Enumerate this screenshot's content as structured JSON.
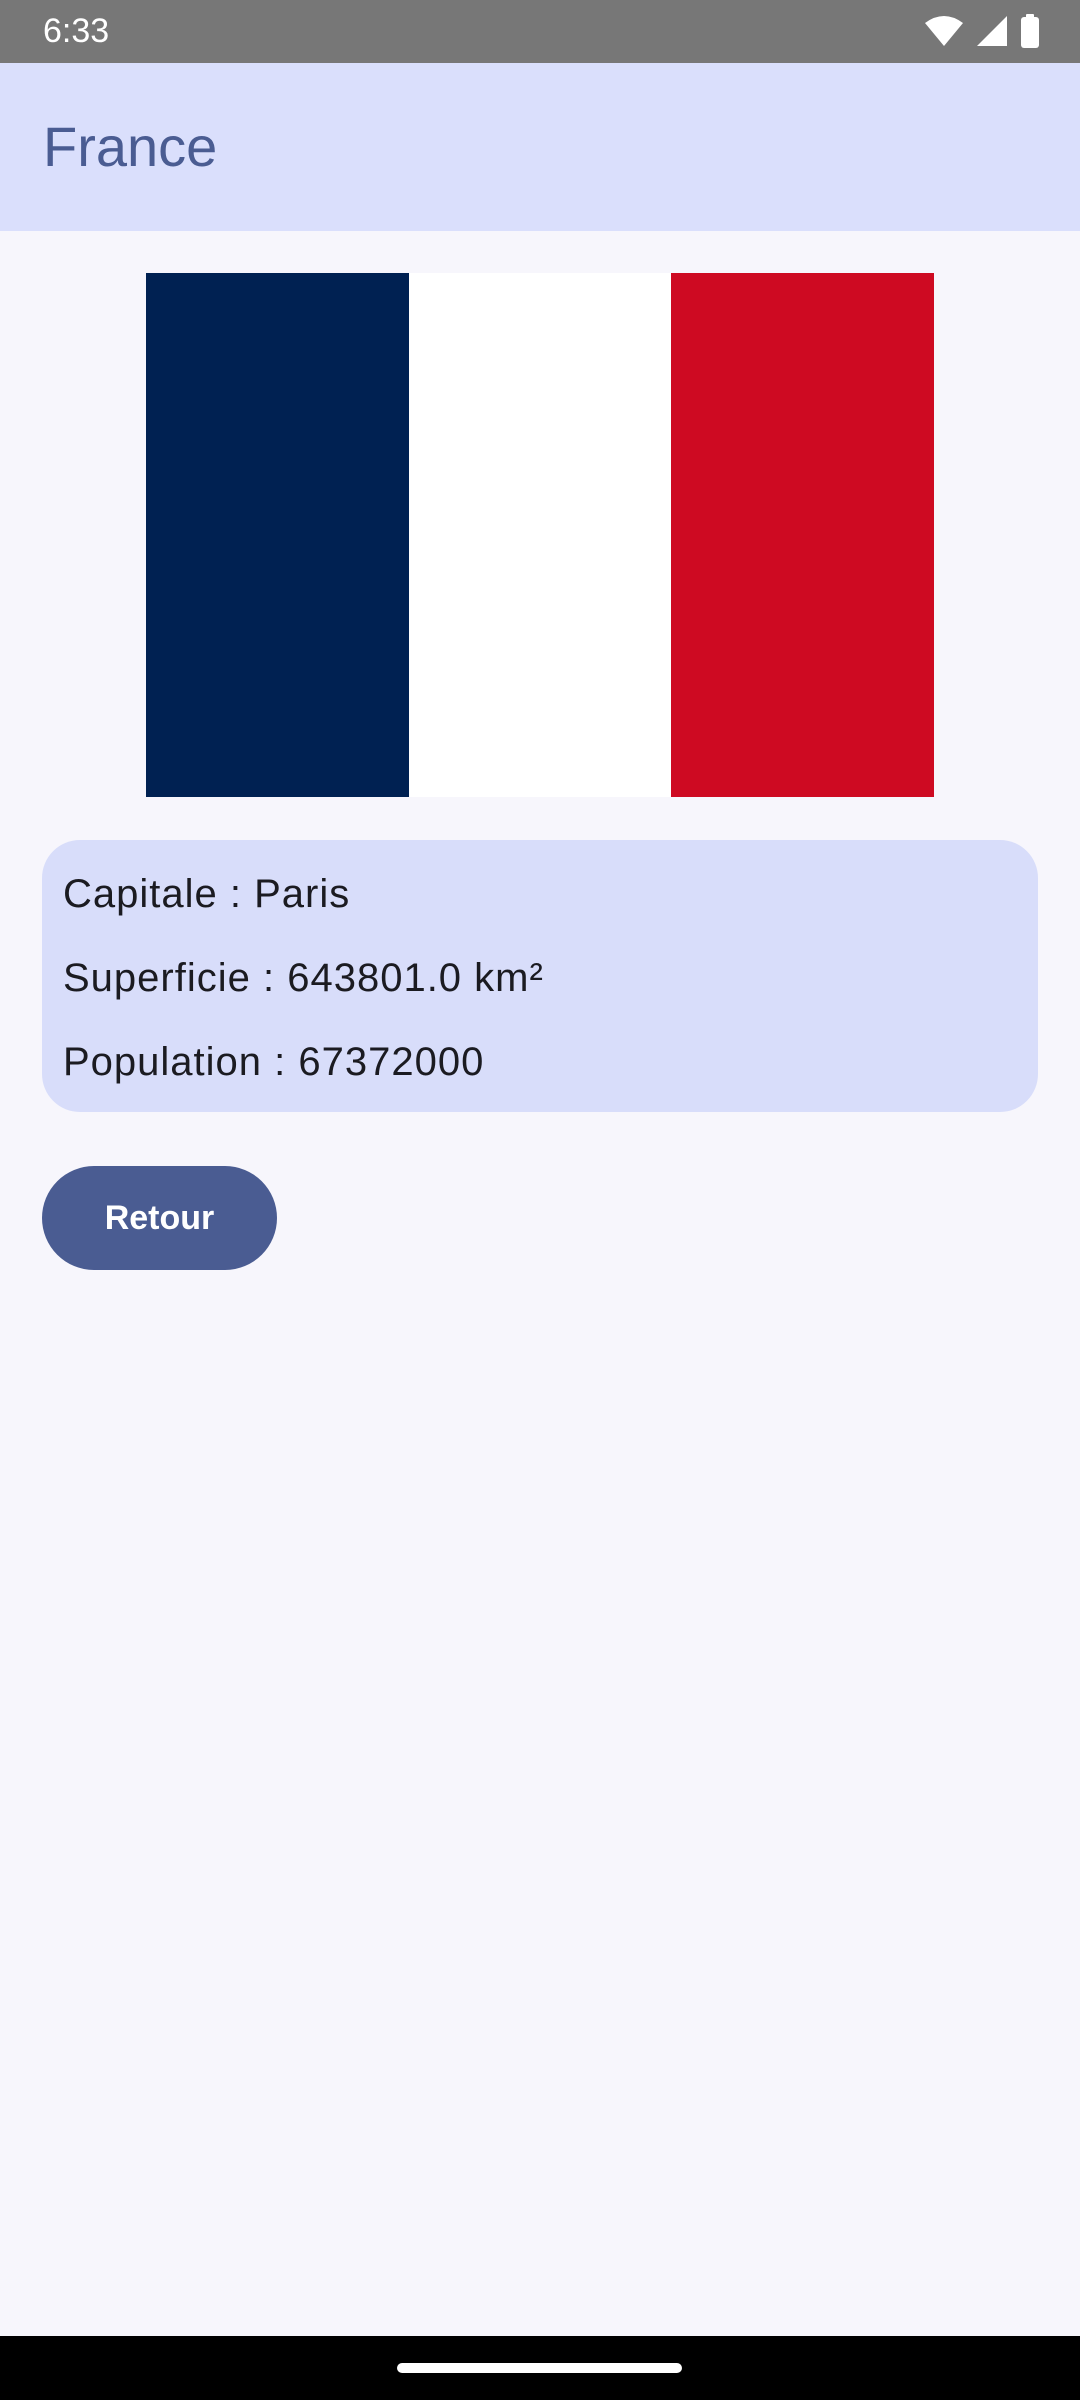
{
  "status_bar": {
    "time": "6:33",
    "icons": [
      "wifi-icon",
      "signal-icon",
      "battery-icon"
    ]
  },
  "app_bar": {
    "title": "France"
  },
  "flag": {
    "country": "France",
    "stripes": [
      "#002152",
      "#ffffff",
      "#ce0a22"
    ]
  },
  "details": {
    "capital": "Capitale : Paris",
    "area": "Superficie : 643801.0 km²",
    "population": "Population : 67372000"
  },
  "actions": {
    "back_label": "Retour"
  },
  "colors": {
    "accent": "#4a5c92",
    "app_bar_bg": "#dadffc",
    "card_bg": "#d8ddfa",
    "background": "#f7f6fc",
    "status_bar_bg": "#777777"
  }
}
